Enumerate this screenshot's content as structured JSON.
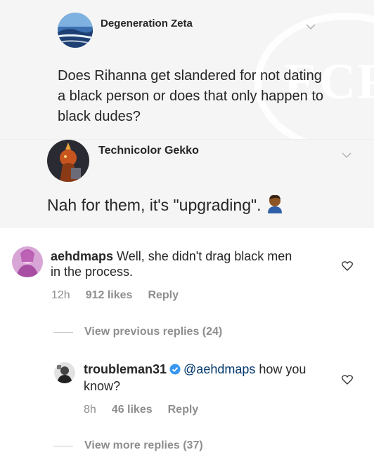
{
  "card1": {
    "user": "Degeneration Zeta",
    "text": "Does Rihanna get slandered for not dating a black person or does that only happen to black dudes?",
    "watermark": "ECR"
  },
  "card2": {
    "user": "Technicolor Gekko",
    "text": "Nah for them, it's \"upgrading\"."
  },
  "comment1": {
    "user": "aehdmaps",
    "text": " Well, she didn't drag black men in the process.",
    "time": "12h",
    "likes": "912 likes",
    "reply": "Reply"
  },
  "view_previous": "View previous replies (24)",
  "comment2": {
    "user": "troubleman31",
    "mention": "@aehdmaps",
    "text": " how you know?",
    "time": "8h",
    "likes": "46 likes",
    "reply": "Reply"
  },
  "view_more": "View more replies (37)",
  "colors": {
    "mention": "#00376b",
    "verified": "#3897f0",
    "meta": "#8e8e8e"
  }
}
